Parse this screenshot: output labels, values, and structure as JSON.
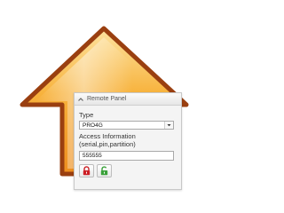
{
  "panel": {
    "title": "Remote Panel",
    "type_label": "Type",
    "type_value": "PRO4G",
    "access_label_line1": "Access Information",
    "access_label_line2": "(serial,pin,partition)",
    "access_value": "555555"
  },
  "icons": {
    "arrow": "up-arrow-icon",
    "collapse": "collapse-chevron-icon",
    "dropdown": "dropdown-arrow-icon",
    "lock": "lock-icon",
    "unlock": "unlock-icon"
  },
  "colors": {
    "arrow_fill": "#f3a52b",
    "arrow_outline": "#9a3f10",
    "lock_red": "#cc1f25",
    "unlock_green": "#3aa13a"
  }
}
